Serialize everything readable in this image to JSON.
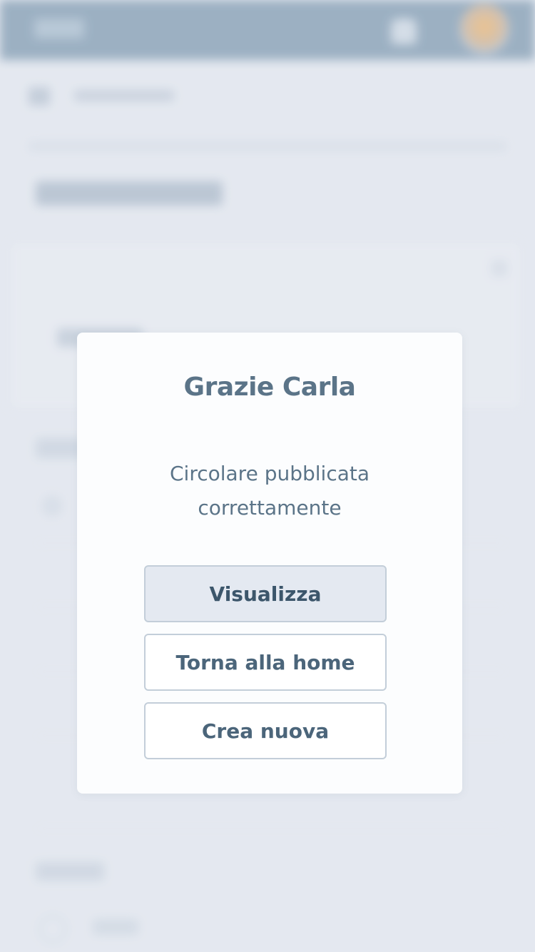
{
  "modal": {
    "title": "Grazie Carla",
    "message": "Circolare pubblicata correttamente",
    "buttons": {
      "view": "Visualizza",
      "home": "Torna alla home",
      "create_new": "Crea nuova"
    }
  },
  "background": {
    "header_icons": [
      "logo",
      "bell-icon",
      "avatar"
    ],
    "breadcrumb_icon": "home-icon"
  },
  "colors": {
    "header": "#6a8aa3",
    "modal_text": "#5b7488",
    "button_border": "#c3ced9",
    "primary_button_bg": "#e4e9f1"
  }
}
